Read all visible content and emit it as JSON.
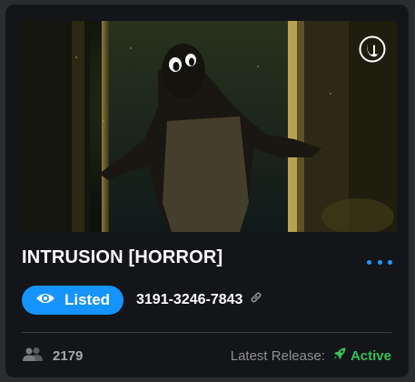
{
  "card": {
    "title": "INTRUSION [HORROR]",
    "thumbnail": {
      "alt": "horror-scene-thumbnail",
      "engine_logo": "unreal-engine-logo"
    },
    "menu_icon": "more-options-icon",
    "status_badge": {
      "label": "Listed",
      "icon": "eye-icon"
    },
    "island_code": "3191-3246-7843",
    "copy_link_icon": "link-icon",
    "players": {
      "icon": "people-icon",
      "count": "2179"
    },
    "latest_release": {
      "label": "Latest Release:",
      "status": "Active",
      "icon": "rocket-icon"
    }
  },
  "colors": {
    "background": "#141519",
    "accent": "#1593ff",
    "active_green": "#33c25a",
    "muted_text": "#a6a7ab"
  }
}
